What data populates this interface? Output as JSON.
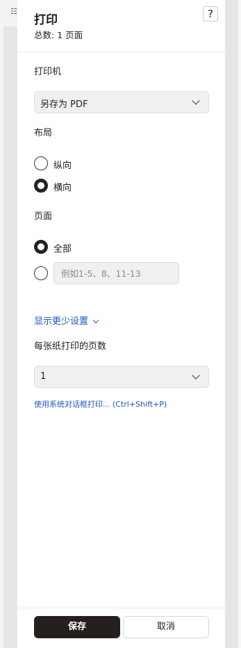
{
  "header": {
    "title": "打印",
    "count_label": "总数:",
    "count_value": "1 页面",
    "help_label": "?"
  },
  "printer": {
    "label": "打印机",
    "selected": "另存为 PDF"
  },
  "layout": {
    "label": "布局",
    "options": [
      {
        "label": "纵向",
        "checked": false
      },
      {
        "label": "横向",
        "checked": true
      }
    ]
  },
  "pages": {
    "label": "页面",
    "all_label": "全部",
    "all_checked": true,
    "custom_checked": false,
    "custom_placeholder": "例如1-5、8、11-13",
    "custom_value": ""
  },
  "more_settings": {
    "toggle_label": "显示更少设置"
  },
  "pages_per_sheet": {
    "label": "每张纸打印的页数",
    "selected": "1"
  },
  "system_dialog_link": "使用系统对话框打印... (Ctrl+Shift+P)",
  "footer": {
    "save_label": "保存",
    "cancel_label": "取消"
  },
  "toolbar_icon": "list-icon"
}
